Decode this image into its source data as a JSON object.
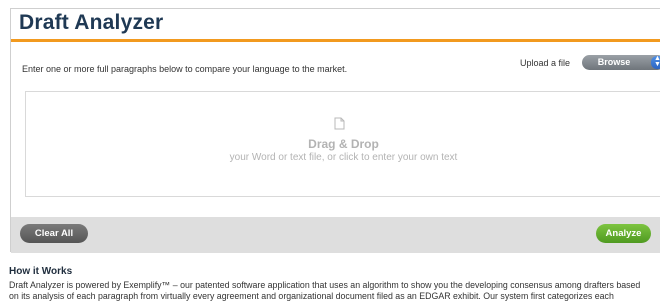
{
  "page": {
    "title": "Draft Analyzer",
    "intro": "Enter one or more full paragraphs below to compare your language to the market.",
    "upload_label": "Upload a file",
    "browse_label": "Browse",
    "dropzone": {
      "icon": "document-icon",
      "title": "Drag & Drop",
      "subtitle": "your Word or text file, or click to enter your own text"
    },
    "buttons": {
      "clear_all": "Clear All",
      "analyze": "Analyze"
    },
    "how_it_works": {
      "title": "How it Works",
      "line1": "Draft Analyzer is powered by Exemplify™ – our patented software application that uses an algorithm to show you the developing consensus among drafters based",
      "line2": "on its analysis of each paragraph from virtually every agreement and organizational document filed as an EDGAR exhibit. Our system first categorizes each"
    },
    "colors": {
      "title": "#1f3954",
      "accent_rule": "#f29a1f",
      "analyze_button": "#5ea82a",
      "clear_button": "#666666",
      "browse_arrows": "#3a78d6"
    }
  }
}
